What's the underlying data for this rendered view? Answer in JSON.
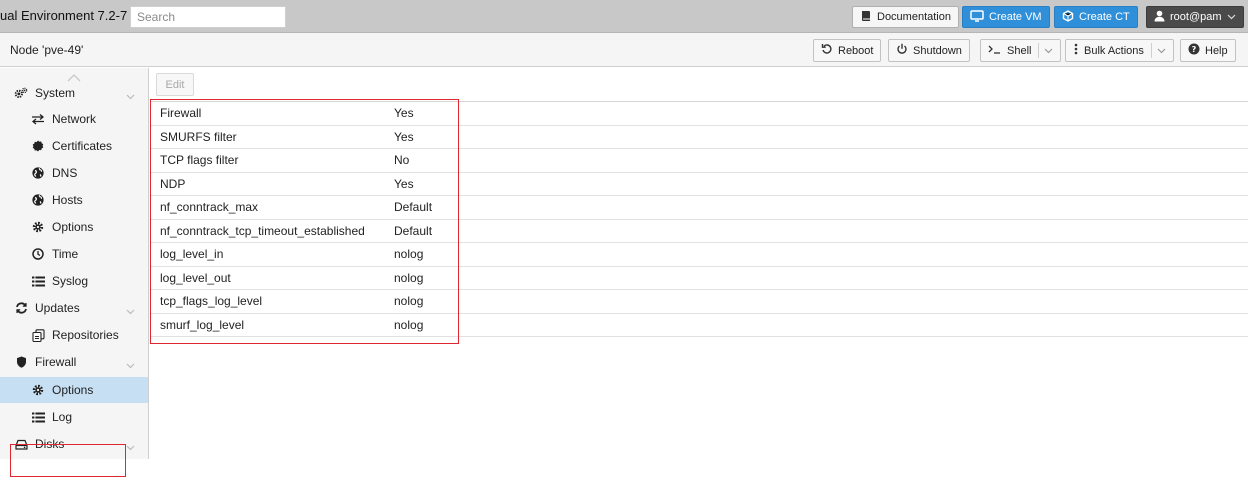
{
  "header": {
    "product_title": "ual Environment 7.2-7",
    "search_placeholder": "Search",
    "documentation_label": "Documentation",
    "create_vm_label": "Create VM",
    "create_ct_label": "Create CT",
    "user_label": "root@pam"
  },
  "node_bar": {
    "title": "Node 'pve-49'",
    "reboot_label": "Reboot",
    "shutdown_label": "Shutdown",
    "shell_label": "Shell",
    "bulk_actions_label": "Bulk Actions",
    "help_label": "Help"
  },
  "sidebar": {
    "items": [
      {
        "label": "System",
        "icon": "gears-icon",
        "kind": "group"
      },
      {
        "label": "Network",
        "icon": "exchange-icon",
        "kind": "child"
      },
      {
        "label": "Certificates",
        "icon": "certificate-icon",
        "kind": "child"
      },
      {
        "label": "DNS",
        "icon": "globe-icon",
        "kind": "child"
      },
      {
        "label": "Hosts",
        "icon": "globe-icon",
        "kind": "child"
      },
      {
        "label": "Options",
        "icon": "gear-icon",
        "kind": "child"
      },
      {
        "label": "Time",
        "icon": "clock-icon",
        "kind": "child"
      },
      {
        "label": "Syslog",
        "icon": "list-icon",
        "kind": "child"
      },
      {
        "label": "Updates",
        "icon": "refresh-icon",
        "kind": "group"
      },
      {
        "label": "Repositories",
        "icon": "files-icon",
        "kind": "child"
      },
      {
        "label": "Firewall",
        "icon": "shield-icon",
        "kind": "group"
      },
      {
        "label": "Options",
        "icon": "gear-icon",
        "kind": "child",
        "selected": true
      },
      {
        "label": "Log",
        "icon": "list-icon",
        "kind": "child"
      },
      {
        "label": "Disks",
        "icon": "hdd-icon",
        "kind": "group"
      }
    ]
  },
  "main": {
    "edit_label": "Edit",
    "options": [
      {
        "key": "Firewall",
        "value": "Yes"
      },
      {
        "key": "SMURFS filter",
        "value": "Yes"
      },
      {
        "key": "TCP flags filter",
        "value": "No"
      },
      {
        "key": "NDP",
        "value": "Yes"
      },
      {
        "key": "nf_conntrack_max",
        "value": "Default"
      },
      {
        "key": "nf_conntrack_tcp_timeout_established",
        "value": "Default"
      },
      {
        "key": "log_level_in",
        "value": "nolog"
      },
      {
        "key": "log_level_out",
        "value": "nolog"
      },
      {
        "key": "tcp_flags_log_level",
        "value": "nolog"
      },
      {
        "key": "smurf_log_level",
        "value": "nolog"
      }
    ]
  },
  "colors": {
    "accent_blue": "#2f8fd8",
    "selected_row": "#c6dff3",
    "highlight_red": "#e0262e"
  }
}
